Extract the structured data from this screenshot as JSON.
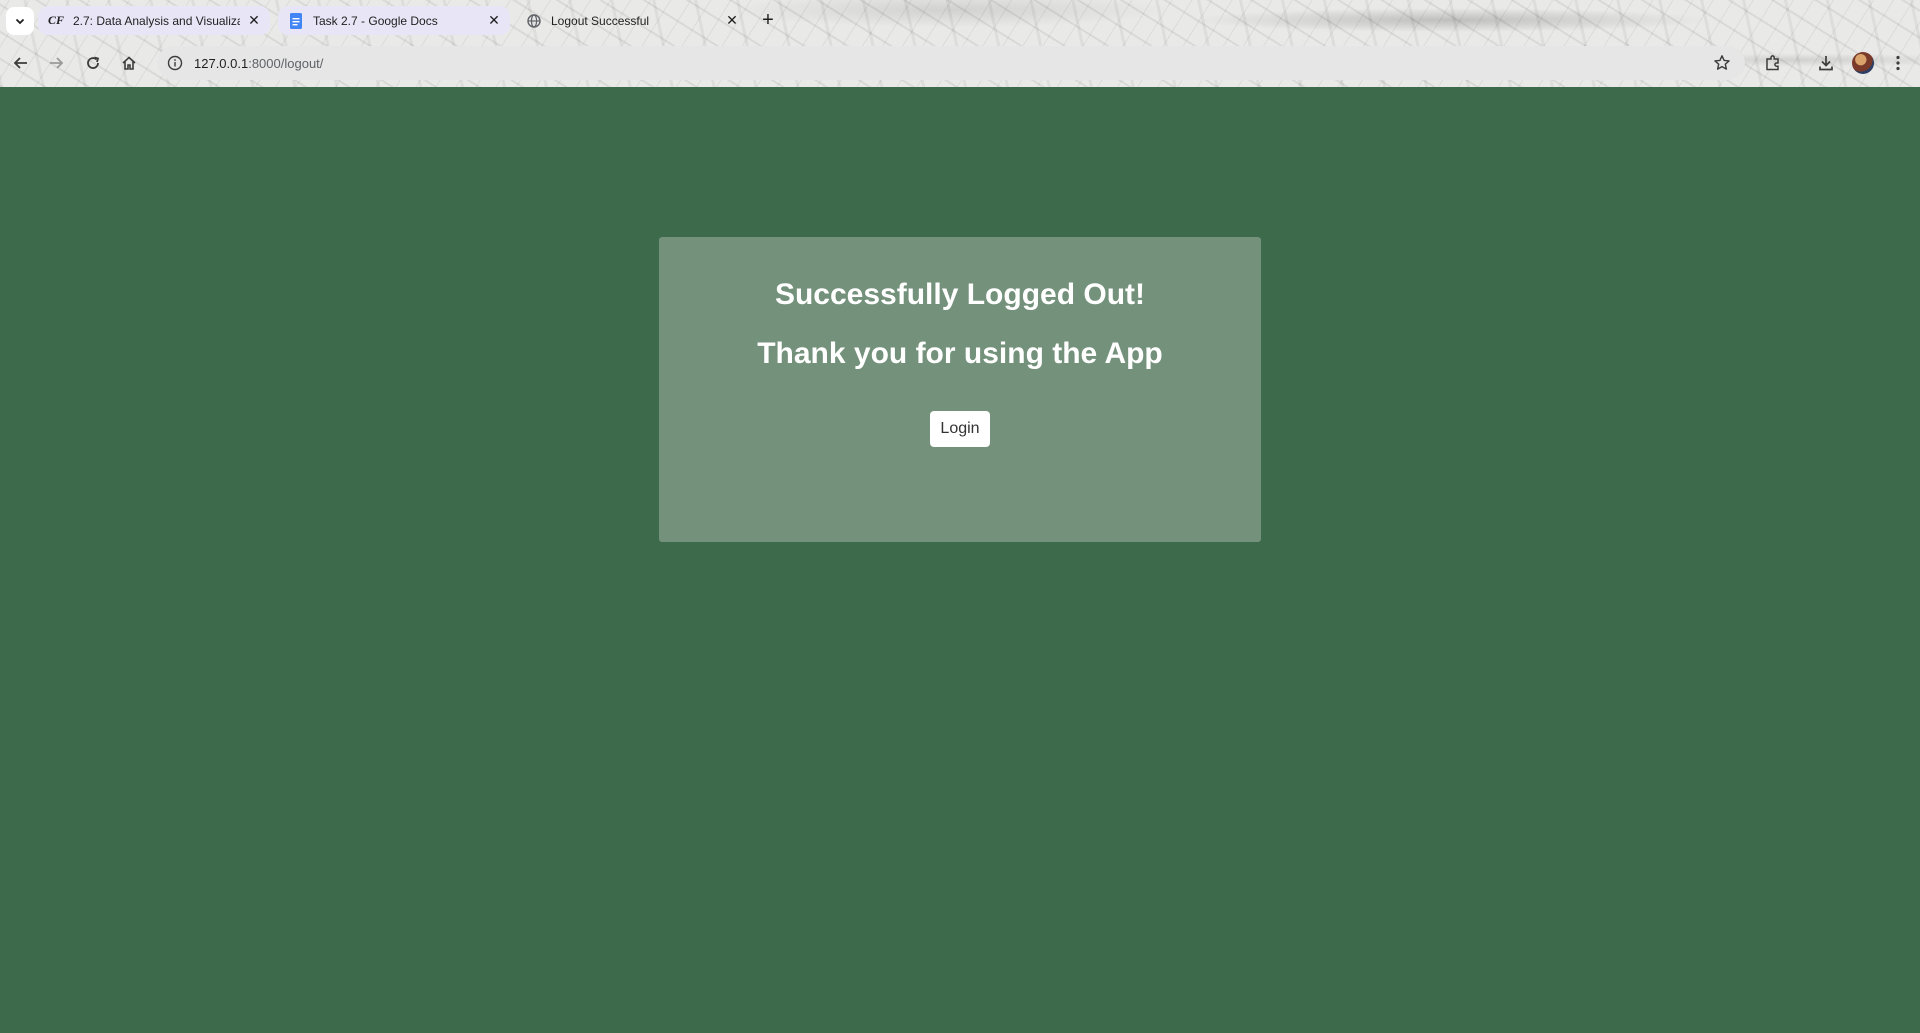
{
  "browser": {
    "tabs": [
      {
        "title": "2.7: Data Analysis and Visualiza",
        "favicon": "cf-logo-icon",
        "active": false
      },
      {
        "title": "Task 2.7 - Google Docs",
        "favicon": "google-docs-icon",
        "active": false
      },
      {
        "title": "Logout Successful",
        "favicon": "globe-icon",
        "active": true
      }
    ],
    "address": {
      "host": "127.0.0.1",
      "rest": ":8000/logout/"
    },
    "colors": {
      "tab_inactive_bg": "#e8e6f6",
      "omnibox_bg": "#e6e6e6"
    }
  },
  "page": {
    "background_color": "#3c6a4b",
    "card_color": "#73917b",
    "heading": "Successfully Logged Out!",
    "subheading": "Thank you for using the App",
    "login_label": "Login"
  }
}
